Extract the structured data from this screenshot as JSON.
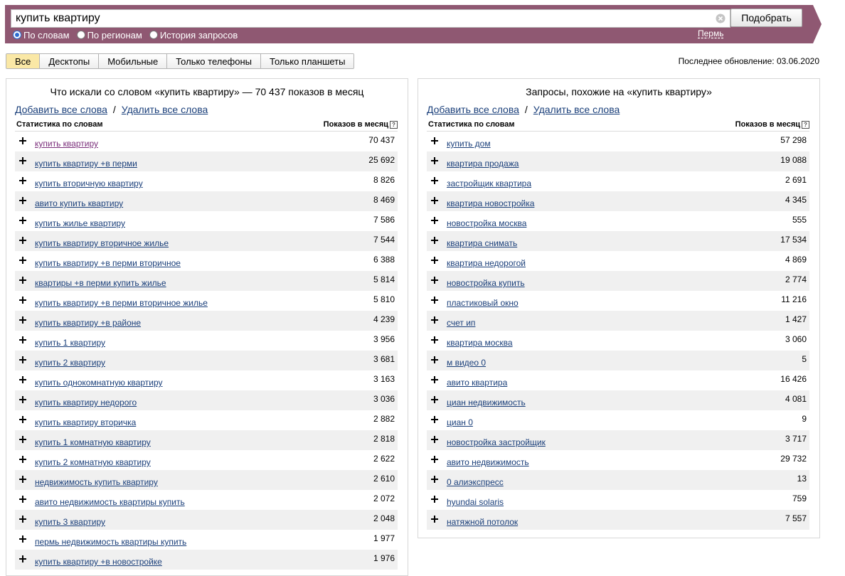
{
  "header": {
    "search_value": "купить квартиру",
    "search_button": "Подобрать",
    "modes": [
      {
        "label": "По словам",
        "selected": true
      },
      {
        "label": "По регионам",
        "selected": false
      },
      {
        "label": "История запросов",
        "selected": false
      }
    ],
    "region": "Пермь",
    "colors": {
      "bar": "#8f5872"
    }
  },
  "tabs": [
    {
      "label": "Все",
      "active": true
    },
    {
      "label": "Десктопы",
      "active": false
    },
    {
      "label": "Мобильные",
      "active": false
    },
    {
      "label": "Только телефоны",
      "active": false
    },
    {
      "label": "Только планшеты",
      "active": false
    }
  ],
  "last_update": "Последнее обновление: 03.06.2020",
  "left_panel": {
    "title": "Что искали со словом «купить квартиру» — 70 437 показов в месяц",
    "add_all": "Добавить все слова",
    "separator": "/",
    "remove_all": "Удалить все слова",
    "col_keyword": "Статистика по словам",
    "col_count": "Показов в месяц",
    "rows": [
      {
        "keyword": "купить квартиру",
        "count": "70 437"
      },
      {
        "keyword": "купить квартиру +в перми",
        "count": "25 692"
      },
      {
        "keyword": "купить вторичную квартиру",
        "count": "8 826"
      },
      {
        "keyword": "авито купить квартиру",
        "count": "8 469"
      },
      {
        "keyword": "купить жилье квартиру",
        "count": "7 586"
      },
      {
        "keyword": "купить квартиру вторичное жилье",
        "count": "7 544"
      },
      {
        "keyword": "купить квартиру +в перми вторичное",
        "count": "6 388"
      },
      {
        "keyword": "квартиры +в перми купить жилье",
        "count": "5 814"
      },
      {
        "keyword": "купить квартиру +в перми вторичное жилье",
        "count": "5 810"
      },
      {
        "keyword": "купить квартиру +в районе",
        "count": "4 239"
      },
      {
        "keyword": "купить 1 квартиру",
        "count": "3 956"
      },
      {
        "keyword": "купить 2 квартиру",
        "count": "3 681"
      },
      {
        "keyword": "купить однокомнатную квартиру",
        "count": "3 163"
      },
      {
        "keyword": "купить квартиру недорого",
        "count": "3 036"
      },
      {
        "keyword": "купить квартиру вторичка",
        "count": "2 882"
      },
      {
        "keyword": "купить 1 комнатную квартиру",
        "count": "2 818"
      },
      {
        "keyword": "купить 2 комнатную квартиру",
        "count": "2 622"
      },
      {
        "keyword": "недвижимость купить квартиру",
        "count": "2 610"
      },
      {
        "keyword": "авито недвижимость квартиры купить",
        "count": "2 072"
      },
      {
        "keyword": "купить 3 квартиру",
        "count": "2 048"
      },
      {
        "keyword": "пермь недвижимость квартиры купить",
        "count": "1 977"
      },
      {
        "keyword": "купить квартиру +в новостройке",
        "count": "1 976"
      }
    ]
  },
  "right_panel": {
    "title": "Запросы, похожие на «купить квартиру»",
    "add_all": "Добавить все слова",
    "separator": "/",
    "remove_all": "Удалить все слова",
    "col_keyword": "Статистика по словам",
    "col_count": "Показов в месяц",
    "rows": [
      {
        "keyword": "купить дом",
        "count": "57 298"
      },
      {
        "keyword": "квартира продажа",
        "count": "19 088"
      },
      {
        "keyword": "застройщик квартира",
        "count": "2 691"
      },
      {
        "keyword": "квартира новостройка",
        "count": "4 345"
      },
      {
        "keyword": "новостройка москва",
        "count": "555"
      },
      {
        "keyword": "квартира снимать",
        "count": "17 534"
      },
      {
        "keyword": "квартира недорогой",
        "count": "4 869"
      },
      {
        "keyword": "новостройка купить",
        "count": "2 774"
      },
      {
        "keyword": "пластиковый окно",
        "count": "11 216"
      },
      {
        "keyword": "счет ип",
        "count": "1 427"
      },
      {
        "keyword": "квартира москва",
        "count": "3 060"
      },
      {
        "keyword": "м видео 0",
        "count": "5"
      },
      {
        "keyword": "авито квартира",
        "count": "16 426"
      },
      {
        "keyword": "циан недвижимость",
        "count": "4 081"
      },
      {
        "keyword": "циан 0",
        "count": "9"
      },
      {
        "keyword": "новостройка застройщик",
        "count": "3 717"
      },
      {
        "keyword": "авито недвижимость",
        "count": "29 732"
      },
      {
        "keyword": "0 алиэкспресс",
        "count": "13"
      },
      {
        "keyword": "hyundai solaris",
        "count": "759"
      },
      {
        "keyword": "натяжной потолок",
        "count": "7 557"
      }
    ]
  }
}
